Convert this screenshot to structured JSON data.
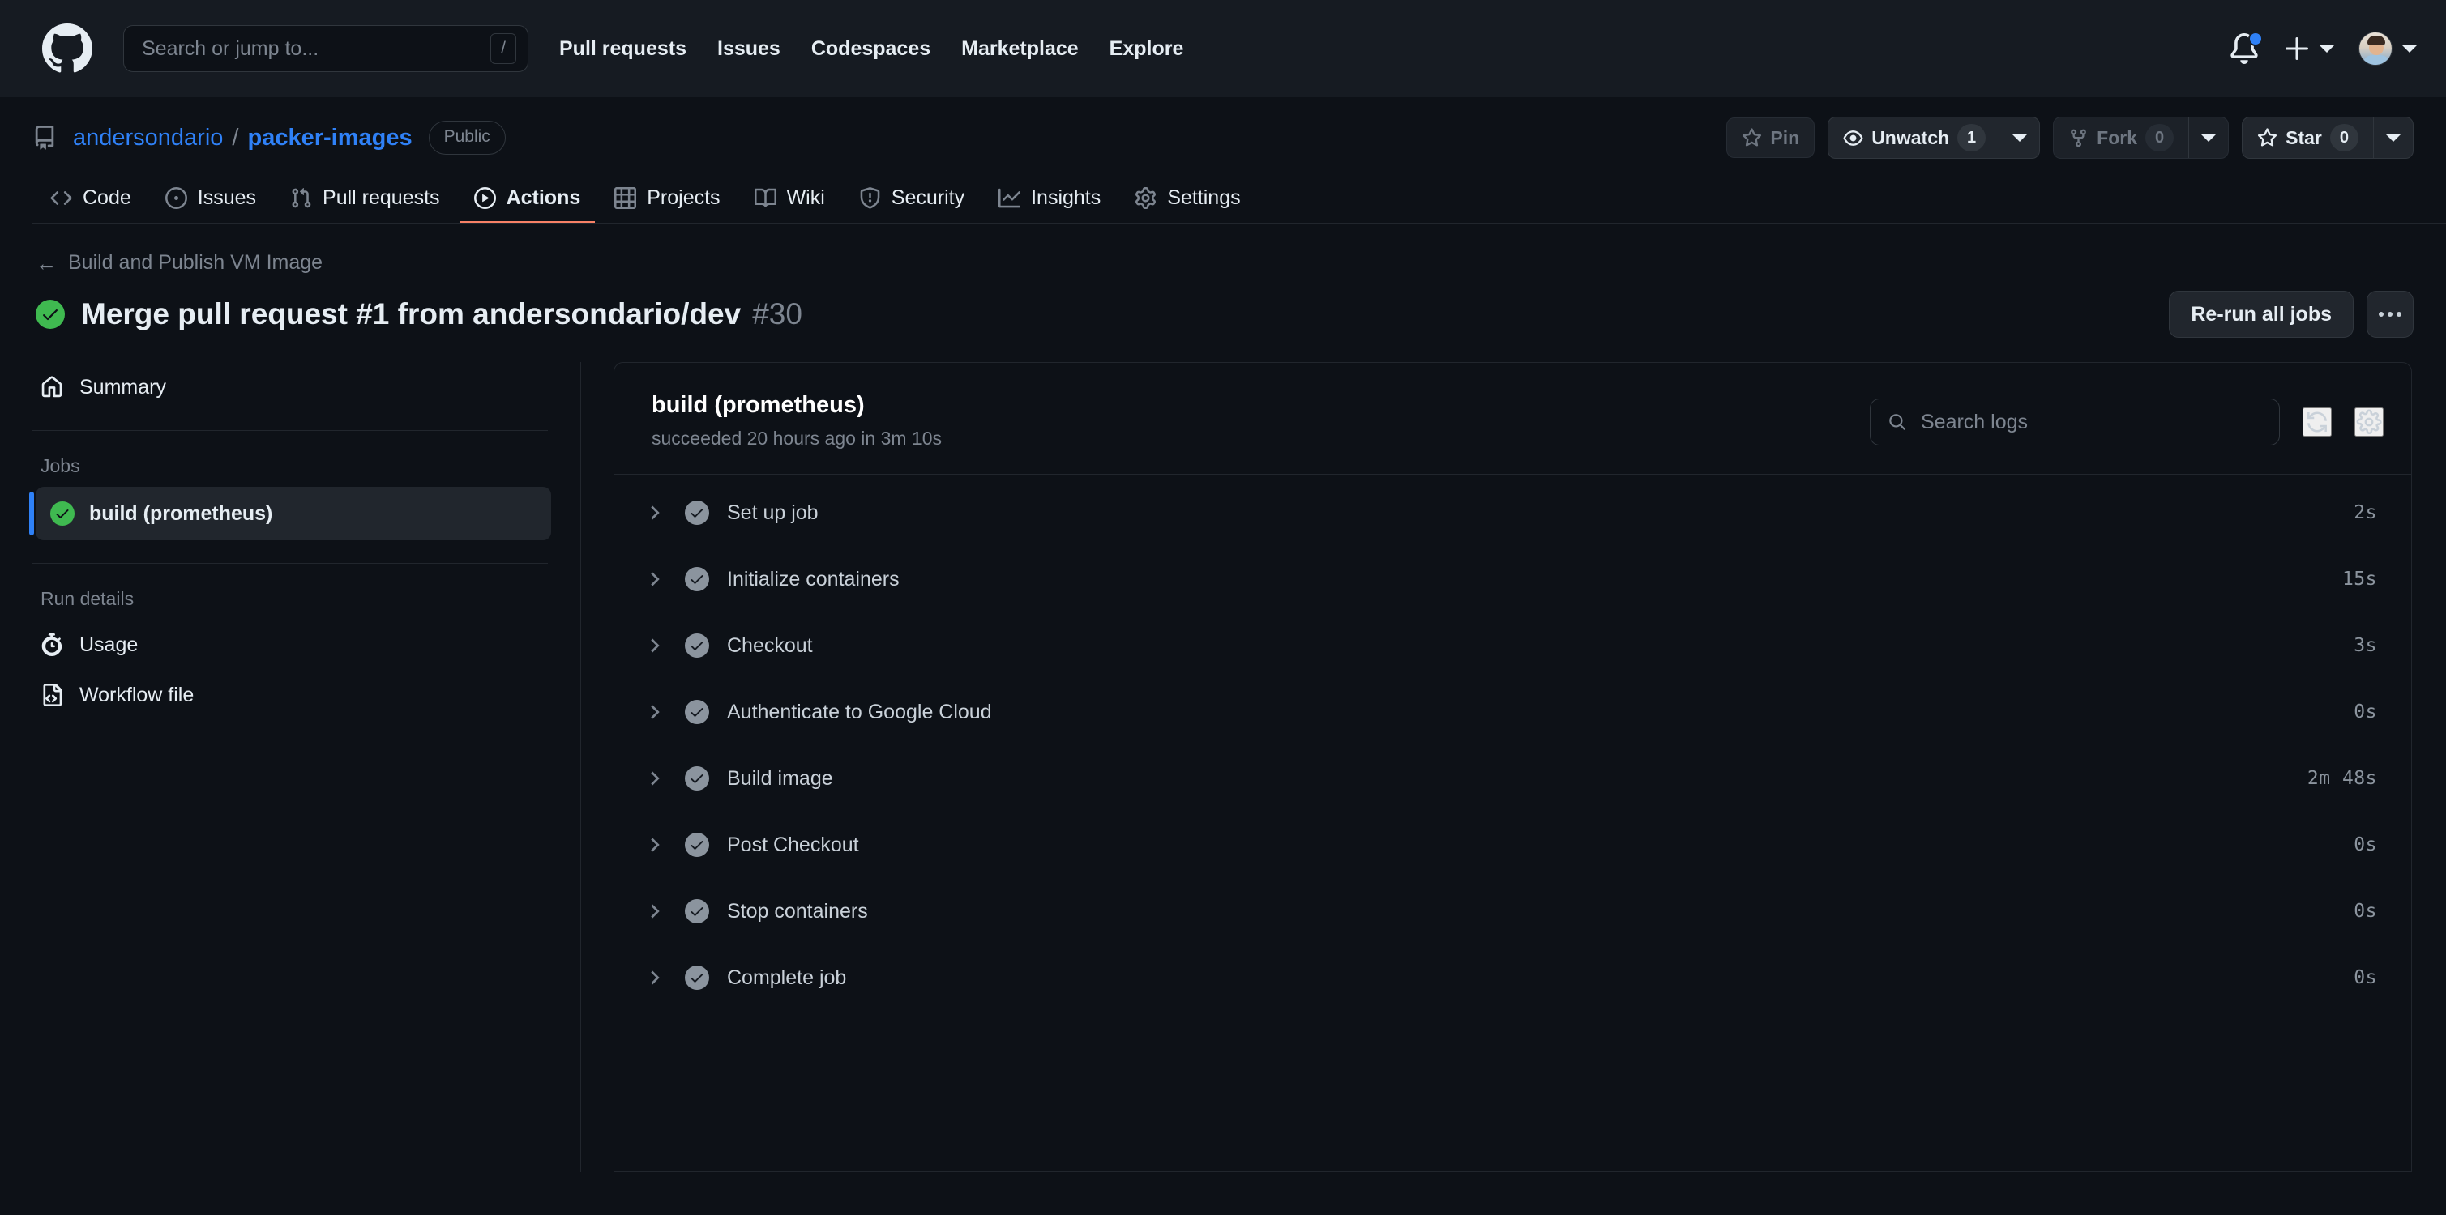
{
  "global_header": {
    "logo_icon": "github-mark-icon",
    "search": {
      "placeholder": "Search or jump to...",
      "value": "",
      "shortcut_key": "/"
    },
    "nav": [
      {
        "label": "Pull requests"
      },
      {
        "label": "Issues"
      },
      {
        "label": "Codespaces"
      },
      {
        "label": "Marketplace"
      },
      {
        "label": "Explore"
      }
    ],
    "notifications_icon": "bell-icon",
    "has_unread_notifications": true,
    "create_new_icon": "plus-icon",
    "account_icon": "avatar",
    "accent_blue": "#2f81f7"
  },
  "repo_header": {
    "repo_icon": "repo-icon",
    "owner": "andersondario",
    "separator": "/",
    "repo": "packer-images",
    "visibility": "Public",
    "actions": {
      "pin": {
        "label": "Pin",
        "icon": "pin-icon",
        "disabled": true
      },
      "watch": {
        "label": "Unwatch",
        "icon": "eye-icon",
        "count": "1"
      },
      "fork": {
        "label": "Fork",
        "icon": "fork-icon",
        "count": "0",
        "disabled": true
      },
      "star": {
        "label": "Star",
        "icon": "star-icon",
        "count": "0"
      }
    },
    "tabs": [
      {
        "label": "Code",
        "icon": "code-icon",
        "active": false
      },
      {
        "label": "Issues",
        "icon": "issue-opened-icon",
        "active": false
      },
      {
        "label": "Pull requests",
        "icon": "git-pull-request-icon",
        "active": false
      },
      {
        "label": "Actions",
        "icon": "play-icon",
        "active": true
      },
      {
        "label": "Projects",
        "icon": "table-icon",
        "active": false
      },
      {
        "label": "Wiki",
        "icon": "book-icon",
        "active": false
      },
      {
        "label": "Security",
        "icon": "shield-icon",
        "active": false
      },
      {
        "label": "Insights",
        "icon": "graph-icon",
        "active": false
      },
      {
        "label": "Settings",
        "icon": "gear-icon",
        "active": false
      }
    ],
    "active_tab_color": "#f78166"
  },
  "run_header": {
    "back_link": "Build and Publish VM Image",
    "back_icon": "arrow-left-icon",
    "status_icon": "check-circle-icon",
    "status_color": "#3fb950",
    "title": "Merge pull request #1 from andersondario/dev",
    "run_number": "#30",
    "rerun_button": "Re-run all jobs",
    "kebab_icon": "kebab-horizontal-icon"
  },
  "sidebar": {
    "summary": {
      "label": "Summary",
      "icon": "home-icon"
    },
    "jobs_heading": "Jobs",
    "jobs": [
      {
        "label": "build (prometheus)",
        "icon": "check-circle-fill-icon",
        "selected": true
      }
    ],
    "run_details_heading": "Run details",
    "run_details": [
      {
        "label": "Usage",
        "icon": "stopwatch-icon"
      },
      {
        "label": "Workflow file",
        "icon": "workflow-file-icon"
      }
    ]
  },
  "job_panel": {
    "title": "build (prometheus)",
    "subtitle": "succeeded 20 hours ago in 3m 10s",
    "search": {
      "placeholder": "Search logs",
      "value": "",
      "icon": "search-icon"
    },
    "refresh_icon": "sync-icon",
    "settings_icon": "gear-icon",
    "steps": [
      {
        "name": "Set up job",
        "duration": "2s",
        "status_icon": "check-circle-icon",
        "expanded": false
      },
      {
        "name": "Initialize containers",
        "duration": "15s",
        "status_icon": "check-circle-icon",
        "expanded": false
      },
      {
        "name": "Checkout",
        "duration": "3s",
        "status_icon": "check-circle-icon",
        "expanded": false
      },
      {
        "name": "Authenticate to Google Cloud",
        "duration": "0s",
        "status_icon": "check-circle-icon",
        "expanded": false
      },
      {
        "name": "Build image",
        "duration": "2m 48s",
        "status_icon": "check-circle-icon",
        "expanded": false
      },
      {
        "name": "Post Checkout",
        "duration": "0s",
        "status_icon": "check-circle-icon",
        "expanded": false
      },
      {
        "name": "Stop containers",
        "duration": "0s",
        "status_icon": "check-circle-icon",
        "expanded": false
      },
      {
        "name": "Complete job",
        "duration": "0s",
        "status_icon": "check-circle-icon",
        "expanded": false
      }
    ]
  }
}
